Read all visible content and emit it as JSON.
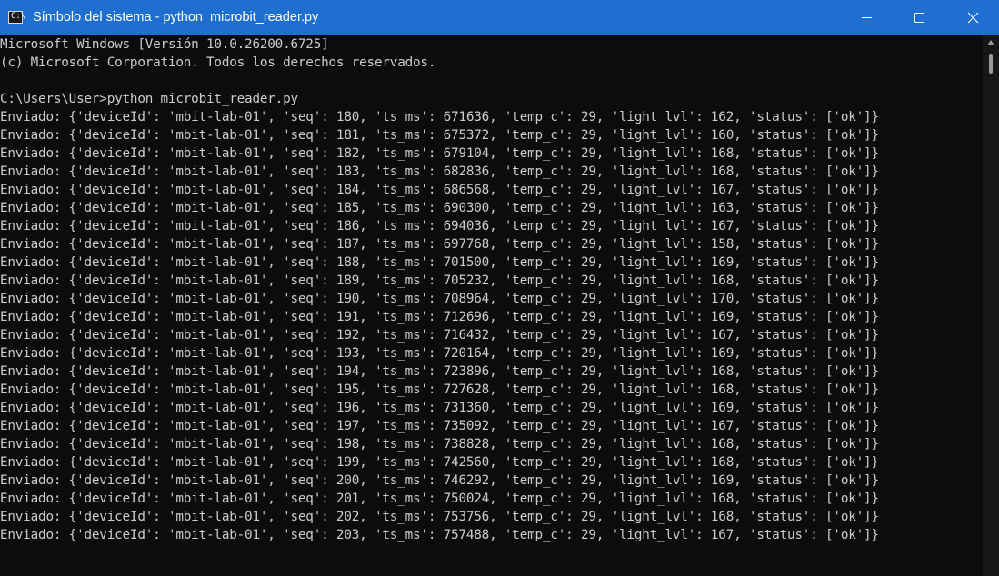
{
  "window": {
    "title": "Símbolo del sistema - python  microbit_reader.py",
    "icon": "cmd-icon",
    "controls": [
      "minimize-icon",
      "maximize-icon",
      "close-icon"
    ]
  },
  "console": {
    "header_lines": [
      "Microsoft Windows [Versión 10.0.26200.6725]",
      "(c) Microsoft Corporation. Todos los derechos reservados.",
      "",
      "C:\\Users\\User>python microbit_reader.py"
    ],
    "output_lines": [
      "Enviado: {'deviceId': 'mbit-lab-01', 'seq': 180, 'ts_ms': 671636, 'temp_c': 29, 'light_lvl': 162, 'status': ['ok']}",
      "Enviado: {'deviceId': 'mbit-lab-01', 'seq': 181, 'ts_ms': 675372, 'temp_c': 29, 'light_lvl': 160, 'status': ['ok']}",
      "Enviado: {'deviceId': 'mbit-lab-01', 'seq': 182, 'ts_ms': 679104, 'temp_c': 29, 'light_lvl': 168, 'status': ['ok']}",
      "Enviado: {'deviceId': 'mbit-lab-01', 'seq': 183, 'ts_ms': 682836, 'temp_c': 29, 'light_lvl': 168, 'status': ['ok']}",
      "Enviado: {'deviceId': 'mbit-lab-01', 'seq': 184, 'ts_ms': 686568, 'temp_c': 29, 'light_lvl': 167, 'status': ['ok']}",
      "Enviado: {'deviceId': 'mbit-lab-01', 'seq': 185, 'ts_ms': 690300, 'temp_c': 29, 'light_lvl': 163, 'status': ['ok']}",
      "Enviado: {'deviceId': 'mbit-lab-01', 'seq': 186, 'ts_ms': 694036, 'temp_c': 29, 'light_lvl': 167, 'status': ['ok']}",
      "Enviado: {'deviceId': 'mbit-lab-01', 'seq': 187, 'ts_ms': 697768, 'temp_c': 29, 'light_lvl': 158, 'status': ['ok']}",
      "Enviado: {'deviceId': 'mbit-lab-01', 'seq': 188, 'ts_ms': 701500, 'temp_c': 29, 'light_lvl': 169, 'status': ['ok']}",
      "Enviado: {'deviceId': 'mbit-lab-01', 'seq': 189, 'ts_ms': 705232, 'temp_c': 29, 'light_lvl': 168, 'status': ['ok']}",
      "Enviado: {'deviceId': 'mbit-lab-01', 'seq': 190, 'ts_ms': 708964, 'temp_c': 29, 'light_lvl': 170, 'status': ['ok']}",
      "Enviado: {'deviceId': 'mbit-lab-01', 'seq': 191, 'ts_ms': 712696, 'temp_c': 29, 'light_lvl': 169, 'status': ['ok']}",
      "Enviado: {'deviceId': 'mbit-lab-01', 'seq': 192, 'ts_ms': 716432, 'temp_c': 29, 'light_lvl': 167, 'status': ['ok']}",
      "Enviado: {'deviceId': 'mbit-lab-01', 'seq': 193, 'ts_ms': 720164, 'temp_c': 29, 'light_lvl': 169, 'status': ['ok']}",
      "Enviado: {'deviceId': 'mbit-lab-01', 'seq': 194, 'ts_ms': 723896, 'temp_c': 29, 'light_lvl': 168, 'status': ['ok']}",
      "Enviado: {'deviceId': 'mbit-lab-01', 'seq': 195, 'ts_ms': 727628, 'temp_c': 29, 'light_lvl': 168, 'status': ['ok']}",
      "Enviado: {'deviceId': 'mbit-lab-01', 'seq': 196, 'ts_ms': 731360, 'temp_c': 29, 'light_lvl': 169, 'status': ['ok']}",
      "Enviado: {'deviceId': 'mbit-lab-01', 'seq': 197, 'ts_ms': 735092, 'temp_c': 29, 'light_lvl': 167, 'status': ['ok']}",
      "Enviado: {'deviceId': 'mbit-lab-01', 'seq': 198, 'ts_ms': 738828, 'temp_c': 29, 'light_lvl': 168, 'status': ['ok']}",
      "Enviado: {'deviceId': 'mbit-lab-01', 'seq': 199, 'ts_ms': 742560, 'temp_c': 29, 'light_lvl': 168, 'status': ['ok']}",
      "Enviado: {'deviceId': 'mbit-lab-01', 'seq': 200, 'ts_ms': 746292, 'temp_c': 29, 'light_lvl': 169, 'status': ['ok']}",
      "Enviado: {'deviceId': 'mbit-lab-01', 'seq': 201, 'ts_ms': 750024, 'temp_c': 29, 'light_lvl': 168, 'status': ['ok']}",
      "Enviado: {'deviceId': 'mbit-lab-01', 'seq': 202, 'ts_ms': 753756, 'temp_c': 29, 'light_lvl': 168, 'status': ['ok']}",
      "Enviado: {'deviceId': 'mbit-lab-01', 'seq': 203, 'ts_ms': 757488, 'temp_c': 29, 'light_lvl': 167, 'status': ['ok']}"
    ]
  },
  "colors": {
    "titlebar": "#1e6fd0",
    "console_bg": "#0c0c0c",
    "console_text": "#cccccc"
  }
}
